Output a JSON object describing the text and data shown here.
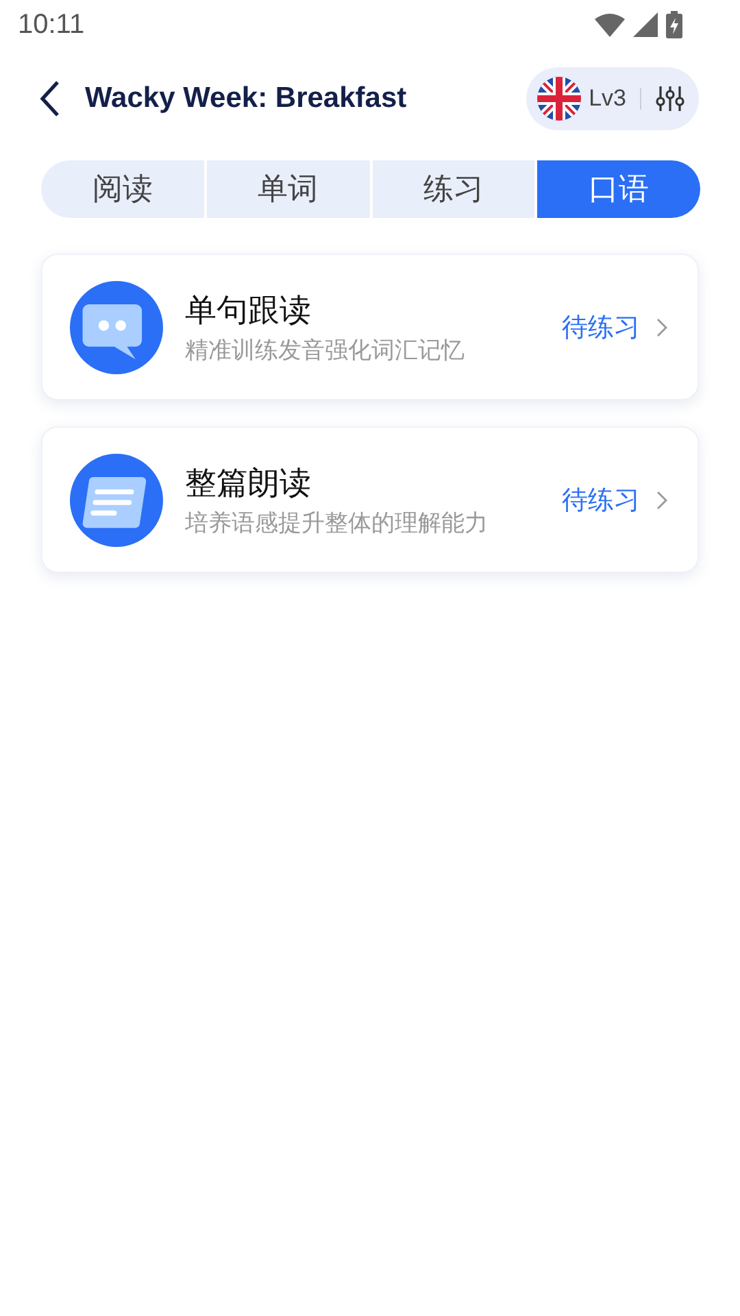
{
  "status_bar": {
    "time": "10:11"
  },
  "header": {
    "title": "Wacky Week: Breakfast",
    "level": "Lv3"
  },
  "tabs": [
    {
      "label": "阅读",
      "selected": false
    },
    {
      "label": "单词",
      "selected": false
    },
    {
      "label": "练习",
      "selected": false
    },
    {
      "label": "口语",
      "selected": true
    }
  ],
  "cards": [
    {
      "kind": "chat",
      "title": "单句跟读",
      "subtitle": "精准训练发音强化词汇记忆",
      "status": "待练习"
    },
    {
      "kind": "doc",
      "title": "整篇朗读",
      "subtitle": "培养语感提升整体的理解能力",
      "status": "待练习"
    }
  ]
}
